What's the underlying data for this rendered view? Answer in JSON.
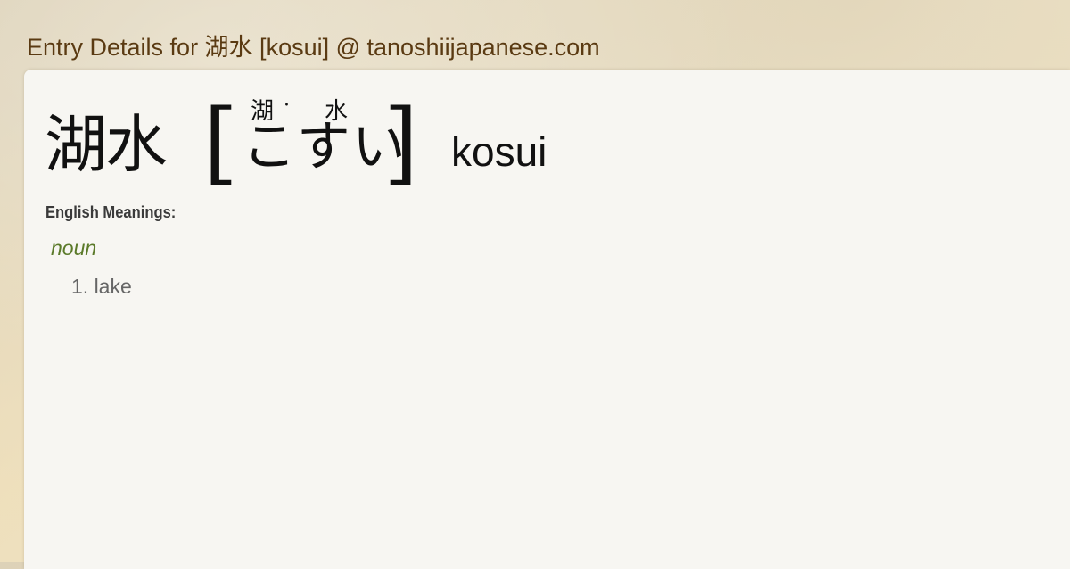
{
  "page": {
    "title": "Entry Details for 湖水 [kosui] @ tanoshiijapanese.com"
  },
  "entry": {
    "kanji": "湖水",
    "bracket_open": "[",
    "bracket_close": "]",
    "furigana": [
      "湖",
      "·",
      "水"
    ],
    "kana": "こすい",
    "romaji": "kosui",
    "meanings_heading": "English Meanings:",
    "part_of_speech": "noun",
    "meanings": [
      "1. lake"
    ]
  },
  "colors": {
    "title": "#5a3a12",
    "part_of_speech": "#5b7a2a",
    "meaning_text": "#666666",
    "card_background": "#f7f6f2"
  }
}
